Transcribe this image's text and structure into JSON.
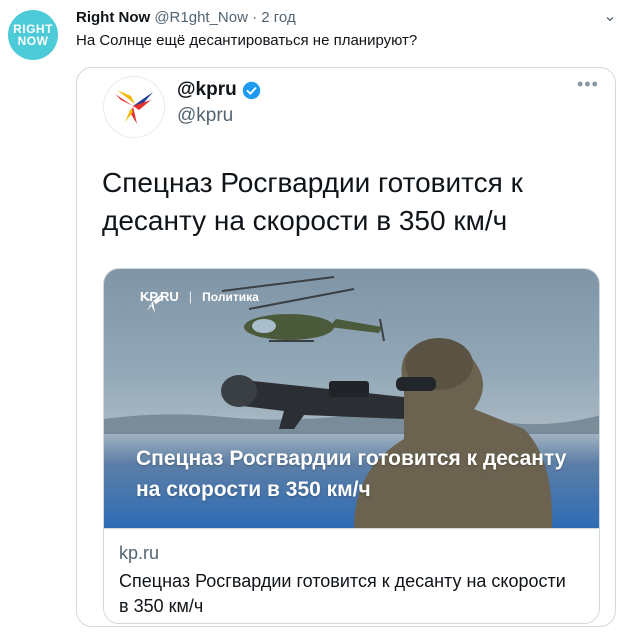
{
  "tweet": {
    "avatar_line1": "RIGHT",
    "avatar_line2": "NOW",
    "author_name": "Right Now",
    "author_handle": "@R1ght_Now",
    "separator": "·",
    "time": "2 год",
    "text": "На Солнце ещё десантироваться не планируют?"
  },
  "quoted": {
    "name": "@kpru",
    "handle": "@kpru",
    "text": "Спецназ Росгвардии готовится к десанту на скорости в 350 км/ч",
    "card": {
      "logo_text": "KP.RU",
      "logo_sep": "|",
      "section": "Политика",
      "headline": "Спецназ Росгвардии готовится к десанту на скорости в 350 км/ч",
      "domain": "kp.ru",
      "title": "Спецназ Росгвардии готовится к десанту на скорости в 350 км/ч"
    }
  },
  "icons": {
    "more": "more-horizontal-icon",
    "verified": "verified-badge-icon",
    "kp_bird": "kp-bird-logo-icon"
  },
  "colors": {
    "avatar_bg": "#4ecbd8",
    "verified": "#1d9bf0",
    "muted": "#536471",
    "border": "#cfd9de",
    "kp_red": "#e6312e",
    "kp_yellow": "#f5b800",
    "kp_blue": "#243c8f"
  }
}
